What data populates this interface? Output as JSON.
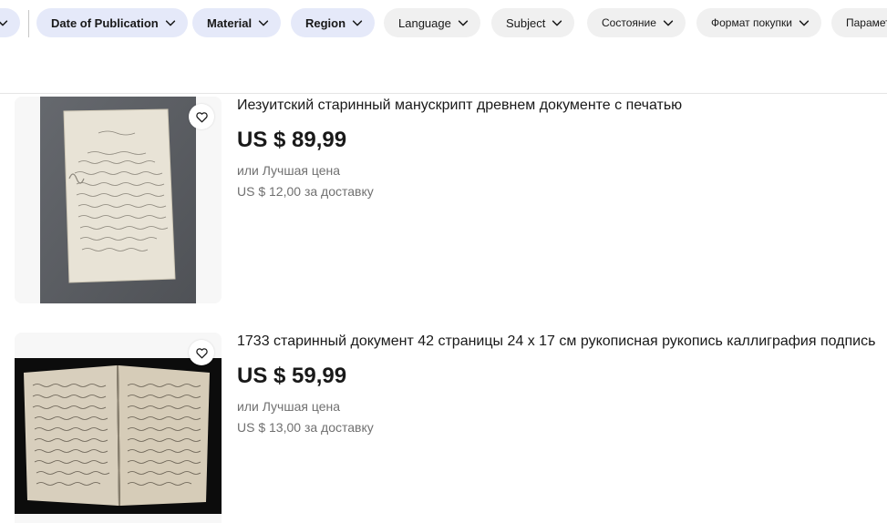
{
  "filters": {
    "chips": [
      {
        "label": ""
      },
      {
        "label": "Date of Publication"
      },
      {
        "label": "Material"
      },
      {
        "label": "Region"
      },
      {
        "label": "Language"
      },
      {
        "label": "Subject"
      },
      {
        "label": "Состояние"
      },
      {
        "label": "Формат покупки"
      },
      {
        "label": "Параметры"
      }
    ],
    "selected_color": "#e5e9f9",
    "plain_color": "#f0f0f0"
  },
  "listings": [
    {
      "title": "Иезуитский старинный манускрипт древнем документе с печатью",
      "price": "US $ 89,99",
      "offer": "или Лучшая цена",
      "shipping": "US $ 12,00 за доставку"
    },
    {
      "title": "1733 старинный документ 42 страницы 24 x 17 см рукописная рукопись каллиграфия подпись",
      "price": "US $ 59,99",
      "offer": "или Лучшая цена",
      "shipping": "US $ 13,00 за доставку"
    }
  ],
  "icons": {
    "chevron": "chevron-down-icon",
    "favorite": "heart-outline-icon"
  }
}
